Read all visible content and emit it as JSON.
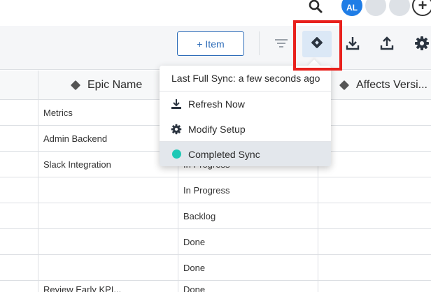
{
  "topbar": {
    "user_initials": "AL",
    "add_user_label": "+"
  },
  "toolbar": {
    "add_item_label": "+ Item"
  },
  "table": {
    "columns": [
      "Epic Name",
      "Affects Versi..."
    ],
    "rows": [
      {
        "epic": "Metrics",
        "status": ""
      },
      {
        "epic": "Admin Backend",
        "status": ""
      },
      {
        "epic": "Slack Integration",
        "status": "In Progress"
      },
      {
        "epic": "",
        "status": "In Progress"
      },
      {
        "epic": "",
        "status": "Backlog"
      },
      {
        "epic": "",
        "status": "Done"
      },
      {
        "epic": "",
        "status": "Done"
      },
      {
        "epic": "Review Early KPI...",
        "status": "Done"
      }
    ]
  },
  "sync_menu": {
    "header": "Last Full Sync: a few seconds ago",
    "refresh_label": "Refresh Now",
    "modify_label": "Modify Setup",
    "completed_label": "Completed Sync",
    "completed_color": "#1ec8b5"
  },
  "colors": {
    "accent": "#2d6cb8",
    "highlight": "#e8201c"
  },
  "icons": [
    "search-icon",
    "filter-icon",
    "jira-sync-icon",
    "download-icon",
    "upload-icon",
    "gear-icon",
    "refresh-icon"
  ]
}
